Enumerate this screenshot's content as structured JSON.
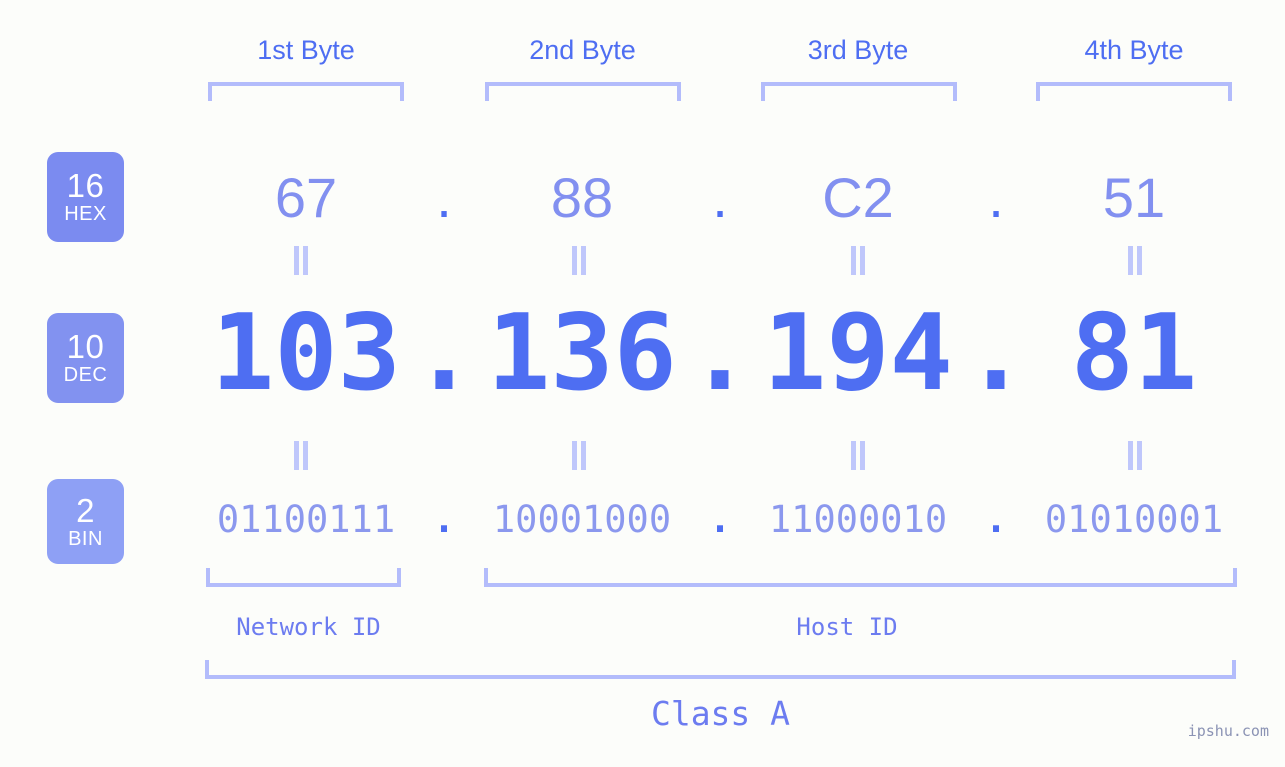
{
  "meta": {
    "watermark": "ipshu.com"
  },
  "byte_headers": [
    {
      "label": "1st Byte"
    },
    {
      "label": "2nd Byte"
    },
    {
      "label": "3rd Byte"
    },
    {
      "label": "4th Byte"
    }
  ],
  "bases": [
    {
      "num": "16",
      "abbr": "HEX"
    },
    {
      "num": "10",
      "abbr": "DEC"
    },
    {
      "num": "2",
      "abbr": "BIN"
    }
  ],
  "rows": {
    "hex": {
      "values": [
        "67",
        "88",
        "C2",
        "51"
      ],
      "separator": "."
    },
    "dec": {
      "values": [
        "103",
        "136",
        "194",
        "81"
      ],
      "separator": "."
    },
    "bin": {
      "values": [
        "01100111",
        "10001000",
        "11000010",
        "01010001"
      ],
      "separator": "."
    }
  },
  "regions": {
    "network_id": "Network ID",
    "host_id": "Host ID",
    "class": "Class A"
  },
  "colors": {
    "background": "#fcfdfa",
    "hex_text": "#8290f0",
    "dec_text": "#4e6ef2",
    "bin_text": "#8b98ee",
    "header_text": "#4e6ef2",
    "bracket": "#b3bcfb",
    "badge_hex": "#7b8bf0",
    "badge_dec": "#8292f0",
    "badge_bin": "#8ea0f5",
    "equals_mark": "#bfc7fb",
    "region_text": "#6c7cf0",
    "watermark_text": "#8b93b4"
  }
}
